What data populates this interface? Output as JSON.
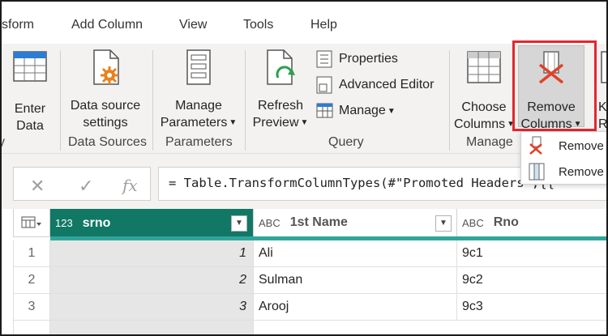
{
  "menu": {
    "items": [
      "sform",
      "Add Column",
      "View",
      "Tools",
      "Help"
    ]
  },
  "ribbon": {
    "enter_data": [
      "Enter",
      "Data"
    ],
    "data_source_settings": [
      "Data source",
      "settings"
    ],
    "manage_parameters": [
      "Manage",
      "Parameters"
    ],
    "refresh_preview": [
      "Refresh",
      "Preview"
    ],
    "properties": "Properties",
    "advanced_editor": "Advanced Editor",
    "manage": "Manage",
    "choose_columns": [
      "Choose",
      "Columns"
    ],
    "remove_columns": [
      "Remove",
      "Columns"
    ],
    "keep_rows_partial": [
      "K",
      "R"
    ],
    "groups": {
      "left_partial": "y",
      "data_sources": "Data Sources",
      "parameters": "Parameters",
      "query": "Query",
      "manage": "Manage"
    }
  },
  "dropdown": {
    "items": [
      "Remove",
      "Remove"
    ]
  },
  "formula_bar": {
    "fx": "fx",
    "formula": "= Table.TransformColumnTypes(#\"Promoted Headers\",{{"
  },
  "grid": {
    "columns": [
      {
        "type": "123",
        "name": "srno"
      },
      {
        "type": "ABC",
        "name": "1st Name"
      },
      {
        "type": "ABC",
        "name": "Rno"
      }
    ],
    "rows": [
      {
        "num": "1",
        "srno": "1",
        "name": "Ali",
        "rno": "9c1"
      },
      {
        "num": "2",
        "srno": "2",
        "name": "Sulman",
        "rno": "9c2"
      },
      {
        "num": "3",
        "srno": "3",
        "name": "Arooj",
        "rno": "9c3"
      }
    ]
  },
  "colors": {
    "accent": "#117865",
    "highlight": "#e3262e",
    "ribbon_bg": "#f3f2f1"
  }
}
